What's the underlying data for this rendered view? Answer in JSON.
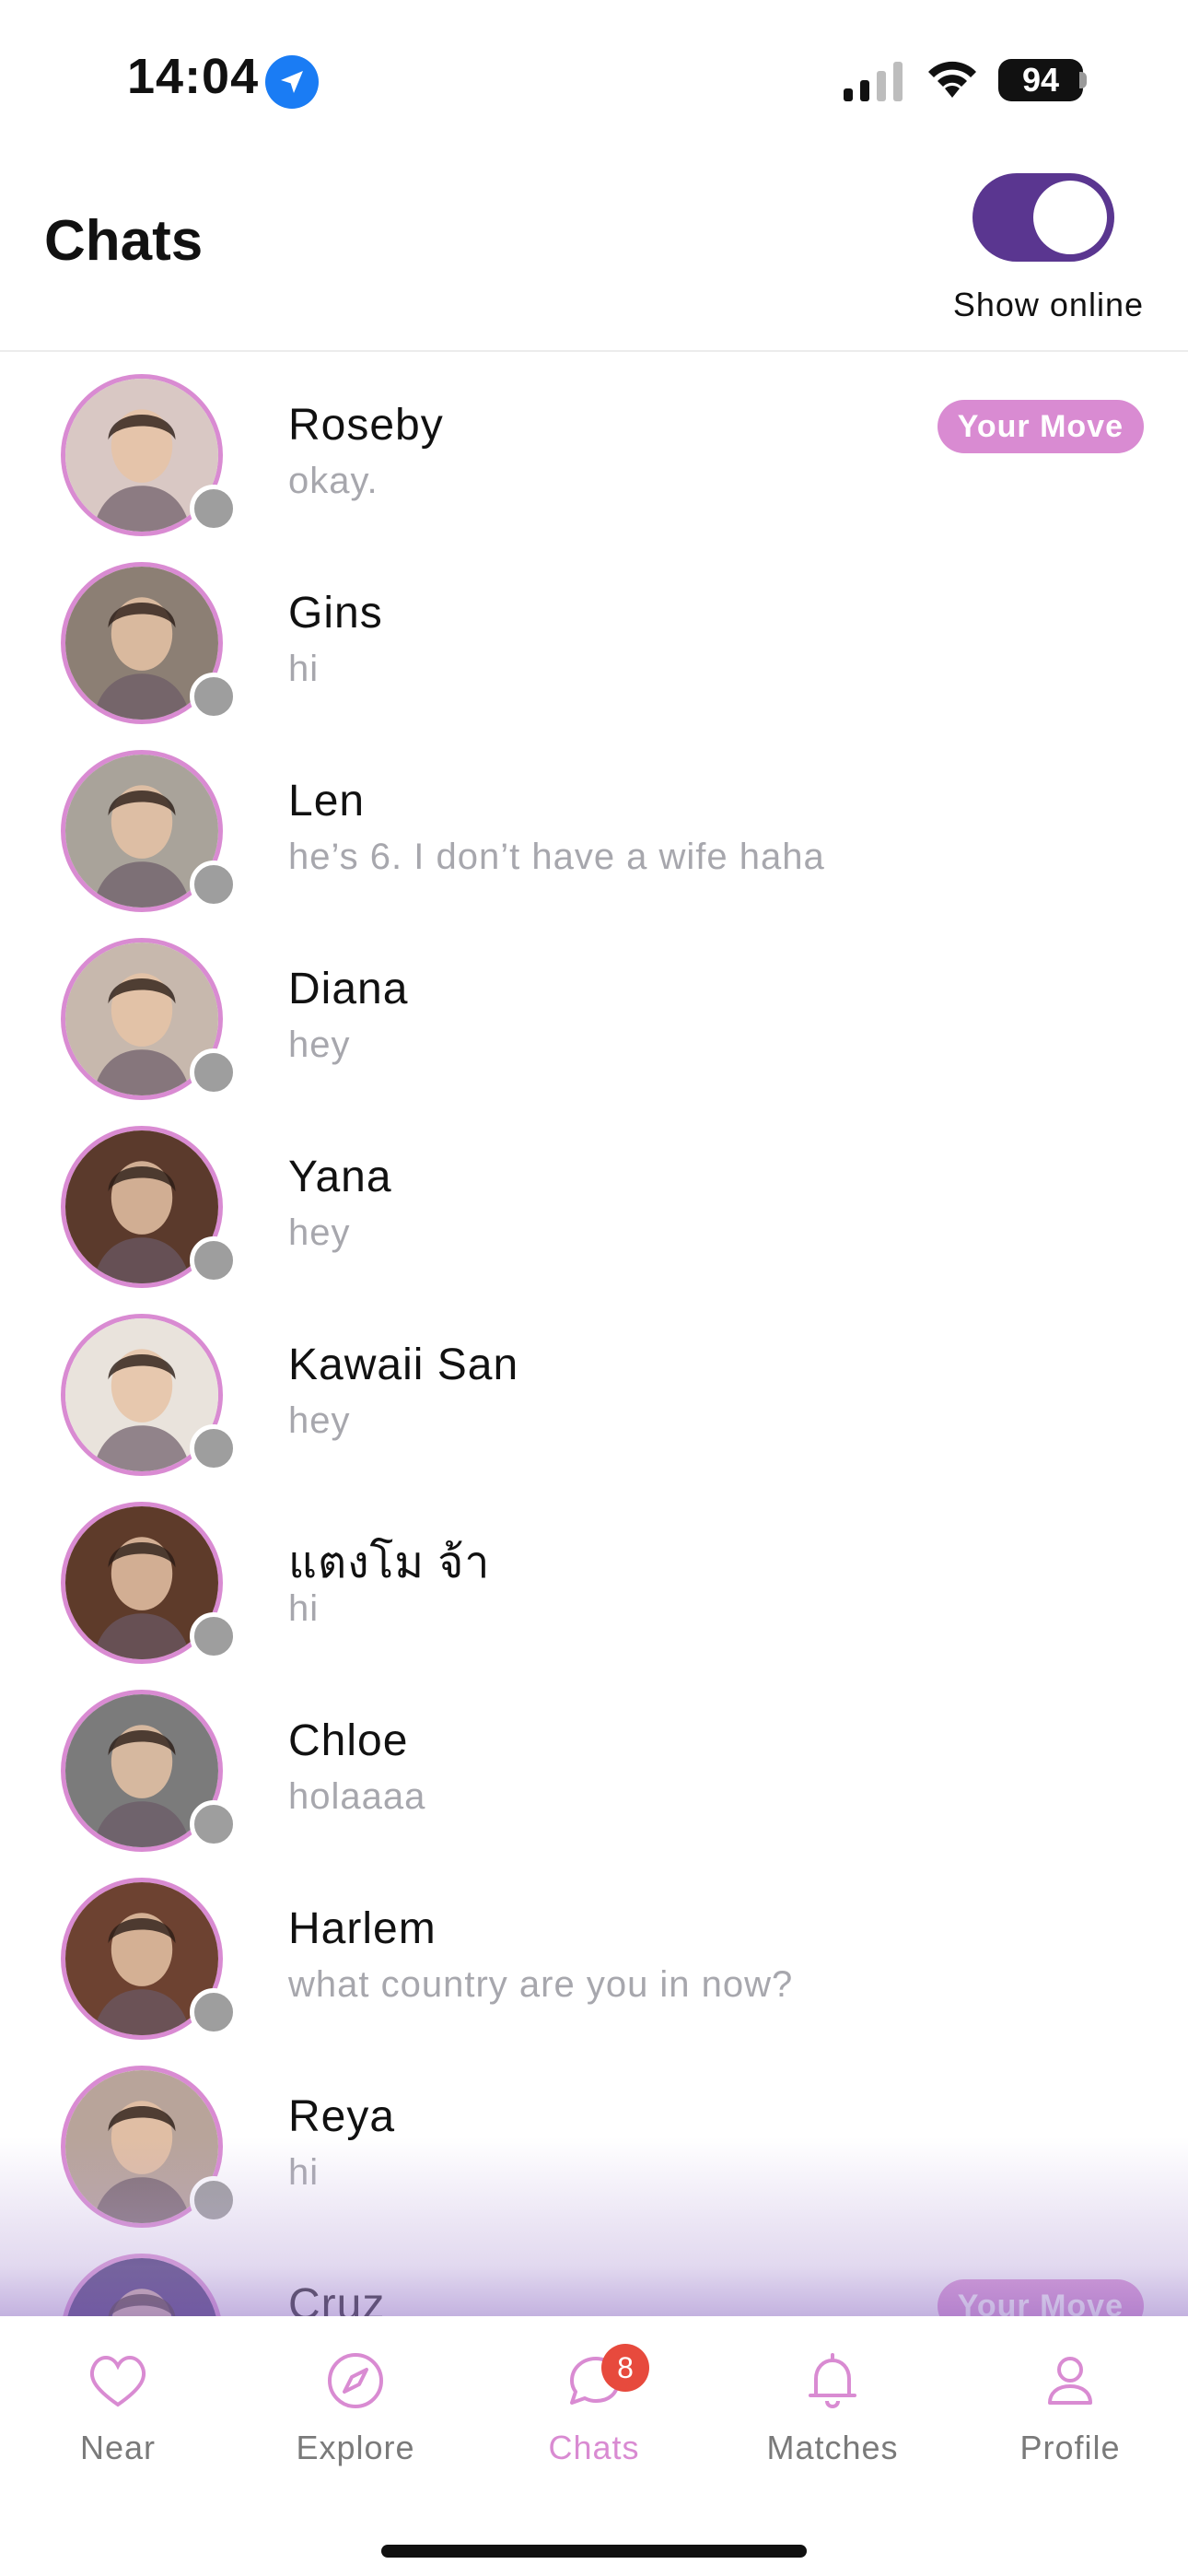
{
  "status_bar": {
    "time": "14:04",
    "battery": "94",
    "icons": [
      "location-arrow-icon",
      "signal-icon",
      "wifi-icon",
      "battery-icon"
    ]
  },
  "header": {
    "title": "Chats",
    "toggle_label": "Show online",
    "toggle_on": true
  },
  "colors": {
    "accent": "#d98bd2",
    "toggle": "#5a3690",
    "badge": "#e74a3d",
    "presence": "#9e9e9e",
    "preview_text": "#a7a7ad"
  },
  "chats": [
    {
      "name": "Roseby",
      "preview": "okay.",
      "badge": "Your Move",
      "avatar_bg": "#d9c8c4"
    },
    {
      "name": "Gins",
      "preview": "hi",
      "badge": "",
      "avatar_bg": "#8c7f74"
    },
    {
      "name": "Len",
      "preview": "he’s 6. I don’t have a wife haha",
      "badge": "",
      "avatar_bg": "#a9a39a"
    },
    {
      "name": "Diana",
      "preview": "hey",
      "badge": "",
      "avatar_bg": "#c7b8ad"
    },
    {
      "name": "Yana",
      "preview": "hey",
      "badge": "",
      "avatar_bg": "#5b3a2c"
    },
    {
      "name": "Kawaii San",
      "preview": "hey",
      "badge": "",
      "avatar_bg": "#e9e3dc"
    },
    {
      "name": "แตงโม จ้า",
      "preview": "hi",
      "badge": "",
      "avatar_bg": "#5e3b2a"
    },
    {
      "name": "Chloe",
      "preview": "holaaaa",
      "badge": "",
      "avatar_bg": "#7b7b7b"
    },
    {
      "name": "Harlem",
      "preview": "what country are you in now?",
      "badge": "",
      "avatar_bg": "#6d4231"
    },
    {
      "name": "Reya",
      "preview": "hi",
      "badge": "",
      "avatar_bg": "#b8a49a"
    },
    {
      "name": "Cruz",
      "preview": "",
      "badge": "Your Move",
      "avatar_bg": "#3a2a6b"
    }
  ],
  "tabs": [
    {
      "label": "Near",
      "icon": "heart-icon",
      "active": false
    },
    {
      "label": "Explore",
      "icon": "compass-icon",
      "active": false
    },
    {
      "label": "Chats",
      "icon": "chat-bubble-icon",
      "active": true,
      "badge": "8"
    },
    {
      "label": "Matches",
      "icon": "bell-icon",
      "active": false
    },
    {
      "label": "Profile",
      "icon": "person-icon",
      "active": false
    }
  ]
}
